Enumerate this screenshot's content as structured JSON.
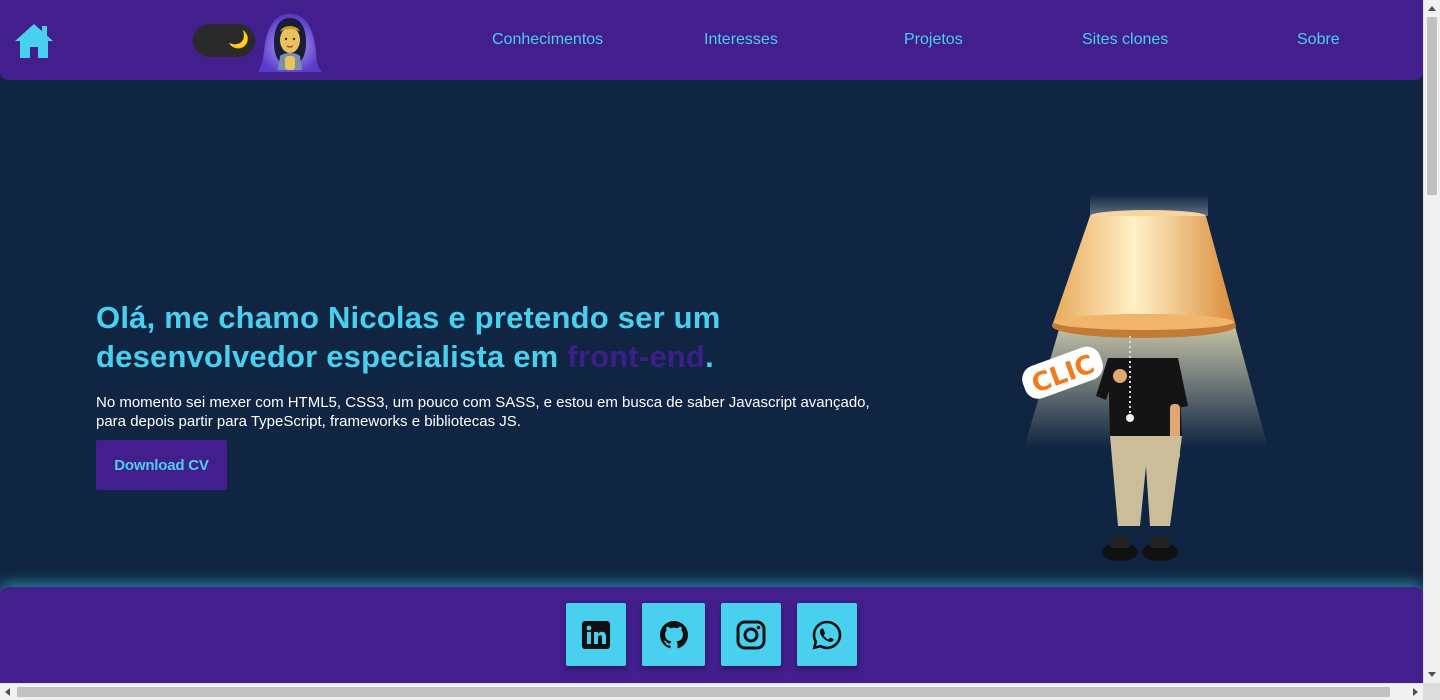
{
  "nav": {
    "items": [
      {
        "label": "Conhecimentos"
      },
      {
        "label": "Interesses"
      },
      {
        "label": "Projetos"
      },
      {
        "label": "Sites clones"
      },
      {
        "label": "Sobre"
      }
    ]
  },
  "theme_toggle": {
    "icon": "moon-icon",
    "glyph": "🌙"
  },
  "hero": {
    "title_main": "Olá, me chamo Nicolas e pretendo ser um desenvolvedor especialista em ",
    "title_accent": "front-end",
    "title_end": ".",
    "description": "No momento sei mexer com HTML5, CSS3, um pouco com SASS, e estou em busca de saber Javascript avançado, para depois partir para TypeScript, frameworks e bibliotecas JS.",
    "button_label": "Download CV"
  },
  "lamp": {
    "sticker_text": "CLIC"
  },
  "footer": {
    "social": [
      {
        "name": "linkedin",
        "icon": "linkedin-icon"
      },
      {
        "name": "github",
        "icon": "github-icon"
      },
      {
        "name": "instagram",
        "icon": "instagram-icon"
      },
      {
        "name": "whatsapp",
        "icon": "whatsapp-icon"
      }
    ]
  },
  "colors": {
    "header_bg": "#431f8e",
    "page_bg": "#0f2542",
    "accent_cyan": "#4ad0ef",
    "accent_purple": "#3d1f8a"
  }
}
